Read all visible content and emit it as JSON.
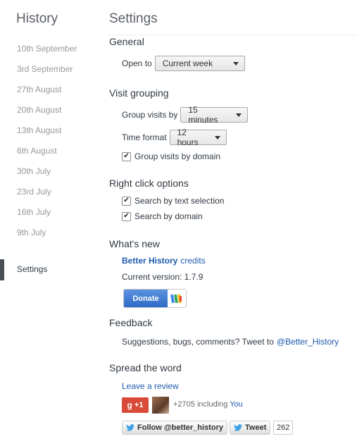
{
  "sidebar": {
    "title": "History",
    "items": [
      "10th September",
      "3rd September",
      "27th August",
      "20th August",
      "13th August",
      "6th August",
      "30th July",
      "23rd July",
      "16th July",
      "9th July"
    ],
    "settings_label": "Settings"
  },
  "main": {
    "title": "Settings",
    "general": {
      "heading": "General",
      "open_to_label": "Open to",
      "open_to_value": "Current week"
    },
    "visit_grouping": {
      "heading": "Visit grouping",
      "group_by_label": "Group visits by",
      "group_by_value": "15 minutes",
      "time_format_label": "Time format",
      "time_format_value": "12 hours",
      "group_by_domain_label": "Group visits by domain",
      "group_by_domain_checked": true
    },
    "right_click": {
      "heading": "Right click options",
      "search_selection_label": "Search by text selection",
      "search_domain_label": "Search by domain"
    },
    "whats_new": {
      "heading": "What's new",
      "app_name": "Better History",
      "credits": "credits",
      "version": "Current version: 1.7.9",
      "donate_label": "Donate"
    },
    "feedback": {
      "heading": "Feedback",
      "text": "Suggestions, bugs, comments? Tweet to",
      "handle": "@Better_History"
    },
    "spread": {
      "heading": "Spread the word",
      "review_link": "Leave a review",
      "gplus_label": "+1",
      "gplus_count_text": "+2705 including",
      "gplus_you": "You",
      "follow_label": "Follow @better_history",
      "tweet_label": "Tweet",
      "tweet_count": "262"
    }
  },
  "colors": {
    "link": "#1e5aad",
    "gplus": "#d94a38",
    "donate": "#2f6bc5"
  }
}
